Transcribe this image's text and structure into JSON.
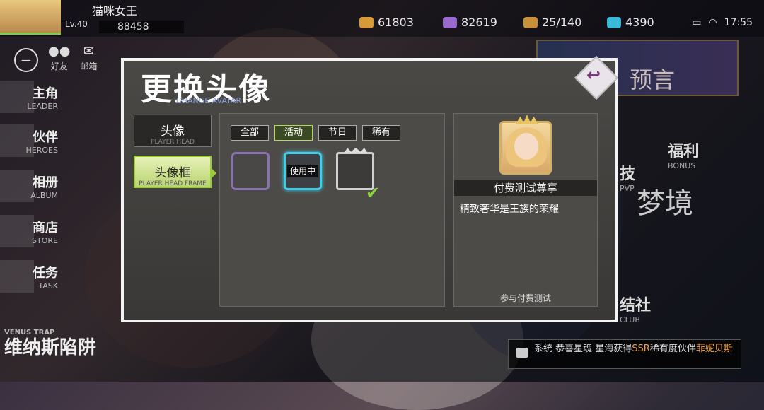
{
  "player": {
    "name": "猫咪女王",
    "level": "Lv.40",
    "power": "88458"
  },
  "resources": [
    {
      "icon": "coin-icon",
      "value": "61803",
      "color": "#d79a3a"
    },
    {
      "icon": "crystal-icon",
      "value": "82619",
      "color": "#9a6ad0"
    },
    {
      "icon": "chest-icon",
      "value": "25/140",
      "color": "#c8903a"
    },
    {
      "icon": "gem-icon",
      "value": "4390",
      "color": "#3ab8d8"
    }
  ],
  "system": {
    "time": "17:55"
  },
  "topnav": [
    {
      "label": "好友"
    },
    {
      "label": "邮箱"
    }
  ],
  "sidenav": [
    {
      "cn": "主角",
      "en": "LEADER"
    },
    {
      "cn": "伙伴",
      "en": "HEROES"
    },
    {
      "cn": "相册",
      "en": "ALBUM"
    },
    {
      "cn": "商店",
      "en": "STORE"
    },
    {
      "cn": "任务",
      "en": "TASK"
    }
  ],
  "right_side": {
    "banner_text": "预言",
    "welfare": {
      "cn": "福利",
      "en": "BONUS"
    },
    "arena": {
      "cn": "技",
      "en": "PVP"
    },
    "dream": "梦境",
    "club": {
      "cn": "结社",
      "en": "CLUB"
    }
  },
  "event": {
    "cn": "维纳斯陷阱",
    "en": "VENUS TRAP"
  },
  "chat": {
    "prefix": "系统 恭喜星魂",
    "middle": "星海获得",
    "rarity": "SSR",
    "suffix": "稀有度伙伴",
    "hero": "菲妮贝斯"
  },
  "dialog": {
    "title": "更换头像",
    "subtitle": "CHANGE AVATAR",
    "tabs": [
      {
        "cn": "头像",
        "en": "PLAYER HEAD"
      },
      {
        "cn": "头像框",
        "en": "PLAYER HEAD FRAME"
      }
    ],
    "filters": [
      {
        "label": "全部"
      },
      {
        "label": "活动"
      },
      {
        "label": "节日"
      },
      {
        "label": "稀有"
      }
    ],
    "in_use_label": "使用中",
    "selected": {
      "name": "付费测试尊享",
      "description": "精致奢华是王族的荣耀",
      "source": "参与付费测试"
    }
  }
}
